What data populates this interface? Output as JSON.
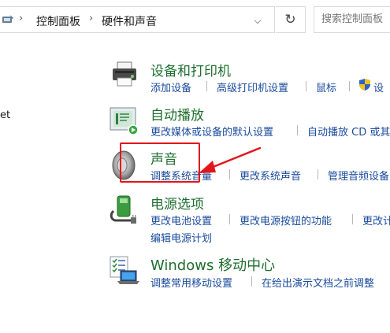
{
  "address_bar": {
    "breadcrumbs": [
      "控制面板",
      "硬件和声音"
    ],
    "search_placeholder": "搜索控制面板"
  },
  "left_stub_text": "et",
  "categories": [
    {
      "title": "设备和打印机",
      "links": [
        "添加设备",
        "高级打印机设置",
        "鼠标",
        "设"
      ]
    },
    {
      "title": "自动播放",
      "links": [
        "更改媒体或设备的默认设置",
        "自动播放 CD 或其"
      ]
    },
    {
      "title": "声音",
      "links": [
        "调整系统音量",
        "更改系统声音",
        "管理音频设备"
      ]
    },
    {
      "title": "电源选项",
      "links": [
        "更改电池设置",
        "更改电源按钮的功能",
        "更改计",
        "编辑电源计划"
      ]
    },
    {
      "title": "Windows 移动中心",
      "links": [
        "调整常用移动设置",
        "在给出演示文档之前调整"
      ]
    }
  ],
  "colors": {
    "title_green": "#1e6e2e",
    "link_blue": "#1a4b9c",
    "annotation_red": "#e3141b"
  },
  "icons": [
    "control-panel-icon",
    "chevron-right-icon",
    "refresh-icon",
    "printer-icon",
    "autoplay-icon",
    "speaker-icon",
    "power-icon",
    "mobility-center-icon",
    "shield-icon"
  ]
}
